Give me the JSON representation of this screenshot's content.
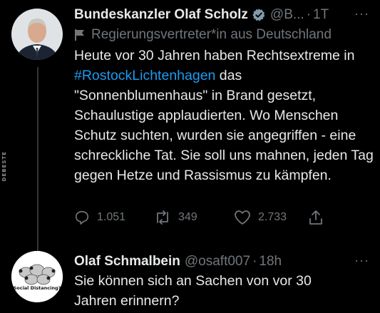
{
  "watermark": "DEBESTE",
  "colors": {
    "background": "#000000",
    "text": "#e7e9ea",
    "muted": "#71767b",
    "link": "#1d9bf0",
    "verified": "#829aab"
  },
  "tweet1": {
    "display_name": "Bundeskanzler Olaf Scholz",
    "verified_icon": "verified-badge-icon",
    "handle": "@B...",
    "separator": "·",
    "time": "1T",
    "more": "···",
    "gov_label_icon": "flag-icon",
    "gov_label": "Regierungsvertreter*in aus Deutschland",
    "text_before": "Heute vor 30 Jahren haben Rechtsextreme in ",
    "hashtag": "#RostockLichtenhagen",
    "text_after": " das \"Sonnenblumenhaus\" in Brand gesetzt, Schaulustige applaudierten. Wo Menschen Schutz suchten, wurden sie angegriffen - eine schreckliche Tat. Sie soll uns mahnen, jeden Tag gegen Hetze und Rassismus zu kämpfen.",
    "replies": "1.051",
    "retweets": "349",
    "likes": "2.733"
  },
  "tweet2": {
    "display_name": "Olaf Schmalbein",
    "handle": "@osaft007",
    "separator": "·",
    "time": "18h",
    "more": "···",
    "avatar_text": "Social Distancing?",
    "text": "Sie können sich an Sachen von vor 30 Jahren erinnern?"
  }
}
